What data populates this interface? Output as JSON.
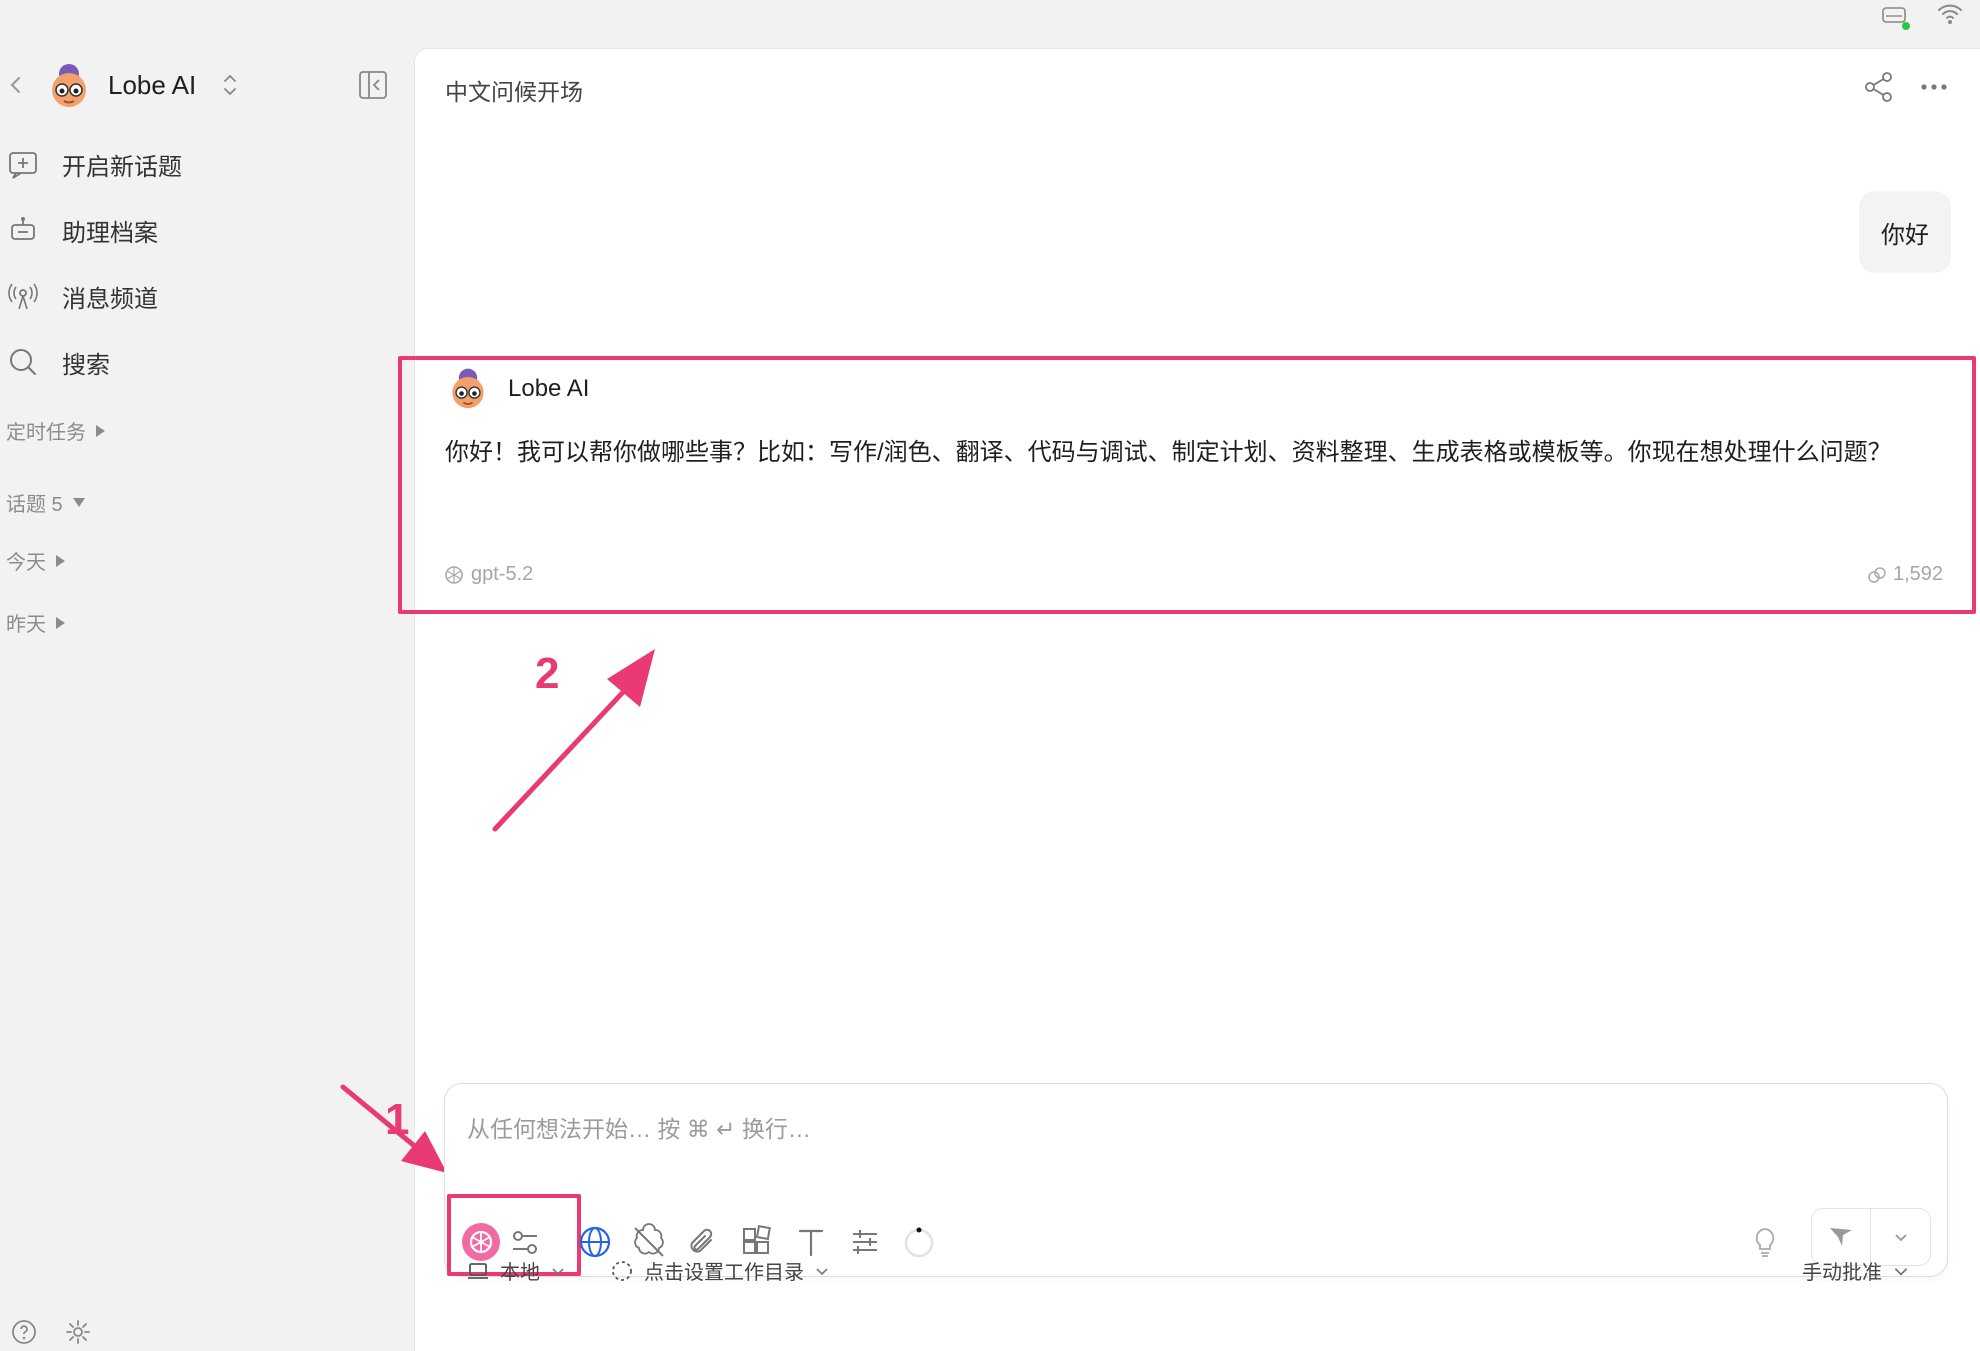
{
  "window": {
    "traffic_lights": [
      "#ff5f57",
      "#febc2e",
      "#28c840"
    ]
  },
  "sidebar": {
    "agent_name": "Lobe AI",
    "nav": [
      {
        "label": "开启新话题",
        "icon": "new-topic-icon"
      },
      {
        "label": "助理档案",
        "icon": "robot-icon"
      },
      {
        "label": "消息频道",
        "icon": "broadcast-icon"
      },
      {
        "label": "搜索",
        "icon": "search-icon"
      }
    ],
    "groups": {
      "scheduled": "定时任务",
      "topics": "话题 5",
      "today": "今天",
      "yesterday": "昨天"
    }
  },
  "chat": {
    "title": "中文问候开场",
    "user_message": "你好",
    "assistant": {
      "name": "Lobe AI",
      "message": "你好！我可以帮你做哪些事？比如：写作/润色、翻译、代码与调试、制定计划、资料整理、生成表格或模板等。你现在想处理什么问题？",
      "model": "gpt-5.2",
      "tokens": "1,592"
    }
  },
  "annotations": {
    "label_1": "1",
    "label_2": "2",
    "color": "#e93a73"
  },
  "composer": {
    "placeholder": "从任何想法开始… 按 ⌘ ↵ 换行…",
    "tools": [
      "model-icon",
      "params-icon",
      "web-search-icon",
      "no-brain-icon",
      "attachment-icon",
      "plugins-icon",
      "text-format-icon",
      "settings-sliders-icon",
      "loading-icon"
    ]
  },
  "footer": {
    "env": "本地",
    "workdir": "点击设置工作目录",
    "approval": "手动批准"
  },
  "accent": "#2563eb"
}
